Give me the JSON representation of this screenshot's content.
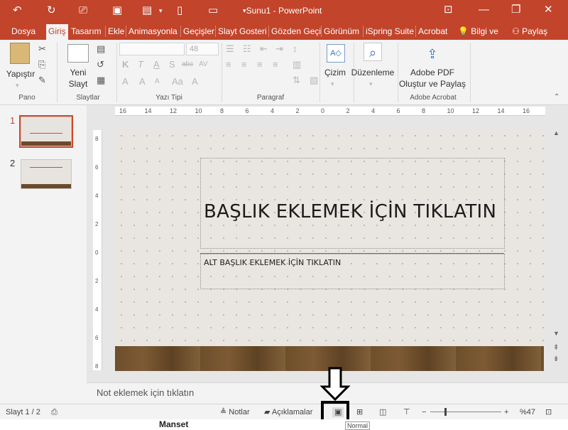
{
  "window": {
    "title": "Sunu1 - PowerPoint",
    "brand_color": "#c1442b"
  },
  "tabs": [
    {
      "label": "Dosya"
    },
    {
      "label": "Giriş"
    },
    {
      "label": "Tasarım"
    },
    {
      "label": "Ekle"
    },
    {
      "label": "Animasyonla"
    },
    {
      "label": "Geçişler"
    },
    {
      "label": "Slayt Gosteri"
    },
    {
      "label": "Gözden Geçi"
    },
    {
      "label": "Görünüm"
    },
    {
      "label": "iSpring Suite"
    },
    {
      "label": "Acrobat"
    }
  ],
  "tell_me": "Bilgi ve",
  "share": "Paylaş",
  "ribbon": {
    "paste": "Yapıştır",
    "new_slide_1": "Yeni",
    "new_slide_2": "Slayt",
    "font_size": "48",
    "drawing": "Çizim",
    "editing": "Düzenleme",
    "adobe_1": "Adobe PDF",
    "adobe_2": "Oluştur ve Paylaş",
    "groups": {
      "clipboard": "Pano",
      "slides": "Slaytlar",
      "font": "Yazı Tipi",
      "paragraph": "Paragraf",
      "acrobat": "Adobe Acrobat"
    }
  },
  "thumbnails": [
    {
      "num": "1"
    },
    {
      "num": "2"
    }
  ],
  "slide": {
    "title": "BAŞLIK EKLEMEK İÇİN TIKLATIN",
    "subtitle": "ALT BAŞLIK EKLEMEK İÇİN TIKLATIN"
  },
  "notes_placeholder": "Not eklemek için tıklatın",
  "status": {
    "slide_info": "Slayt 1 / 2",
    "notes": "Notlar",
    "comments": "Açıklamalar",
    "zoom": "%47"
  },
  "ruler_h": [
    "16",
    "14",
    "12",
    "10",
    "8",
    "6",
    "4",
    "2",
    "0",
    "2",
    "4",
    "6",
    "8",
    "10",
    "12",
    "14",
    "16"
  ],
  "ruler_v": [
    "8",
    "6",
    "4",
    "2",
    "0",
    "2",
    "4",
    "6",
    "8"
  ],
  "bottom_text": "Manset",
  "tooltip": "Normal"
}
